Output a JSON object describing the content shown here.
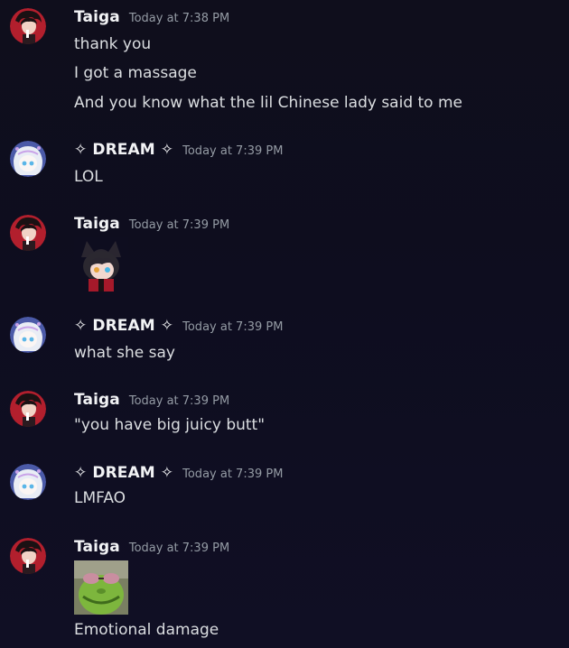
{
  "messages": [
    {
      "user": "Taiga",
      "time": "Today at 7:38 PM",
      "lines": [
        "thank you",
        "I got a massage",
        "And you know what the lil Chinese lady said to me"
      ]
    },
    {
      "user": "✧ DREAM ✧",
      "time": "Today at 7:39 PM",
      "lines": [
        "LOL"
      ]
    },
    {
      "user": "Taiga",
      "time": "Today at 7:39 PM",
      "attachment": "cat-eared-character-sticker"
    },
    {
      "user": "✧ DREAM ✧",
      "time": "Today at 7:39 PM",
      "lines": [
        "what she say"
      ]
    },
    {
      "user": "Taiga",
      "time": "Today at 7:39 PM",
      "lines": [
        "\"you have big juicy butt\""
      ]
    },
    {
      "user": "✧ DREAM ✧",
      "time": "Today at 7:39 PM",
      "lines": [
        "LMFAO"
      ]
    },
    {
      "user": "Taiga",
      "time": "Today at 7:39 PM",
      "attachment": "green-face-sunglasses-image",
      "lines": [
        "Emotional damage"
      ]
    }
  ],
  "colors": {
    "background": "#0f0e1c",
    "username": "#f2f3f5",
    "timestamp": "#949ba4",
    "message_text": "#dbdee1"
  }
}
